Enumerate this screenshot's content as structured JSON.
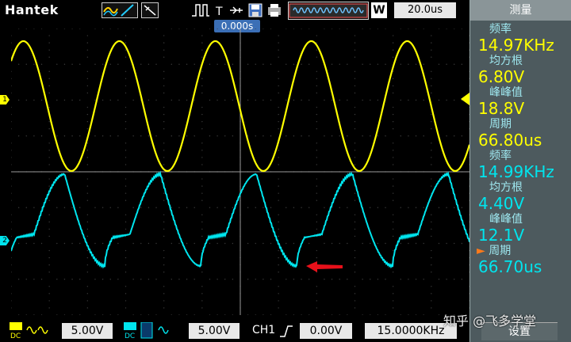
{
  "topbar": {
    "brand": "Hantek",
    "w_badge": "W",
    "timebase": "20.0us",
    "trigger_position": "0.000s"
  },
  "markers": {
    "ch1": "1",
    "ch2": "2"
  },
  "panel": {
    "title": "测量",
    "items": [
      {
        "label": "频率",
        "value": "14.97KHz"
      },
      {
        "label": "均方根",
        "value": "6.80V"
      },
      {
        "label": "峰峰值",
        "value": "18.8V"
      },
      {
        "label": "周期",
        "value": "66.80us"
      },
      {
        "label": "频率",
        "value": "14.99KHz"
      },
      {
        "label": "均方根",
        "value": "4.40V"
      },
      {
        "label": "峰峰值",
        "value": "12.1V"
      },
      {
        "label": "周期",
        "value": "66.70us"
      }
    ],
    "button": "设置"
  },
  "bottombar": {
    "ch1_scale": "5.00V",
    "ch2_scale": "5.00V",
    "trigger_source": "CH1",
    "trigger_level": "0.00V",
    "frequency": "15.0000KHz"
  },
  "watermark": "知乎 @飞多学堂",
  "colors": {
    "ch1": "#ffff00",
    "ch2": "#00e5ee",
    "arrow": "#e8101a",
    "grid": "#3a3a3a"
  }
}
